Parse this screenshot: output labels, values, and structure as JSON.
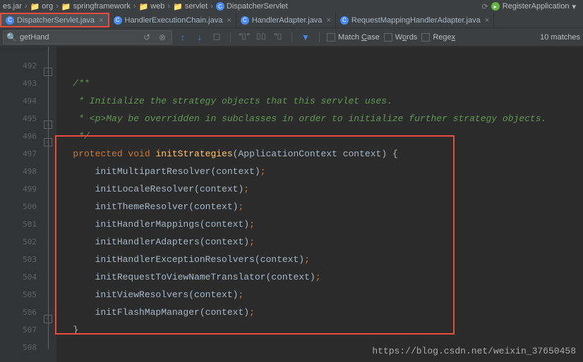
{
  "breadcrumb": {
    "items": [
      "es.jar",
      "org",
      "springframework",
      "web",
      "servlet",
      "DispatcherServlet"
    ]
  },
  "run_config": "RegisterApplication",
  "tabs": [
    {
      "label": "DispatcherServlet.java",
      "active": true
    },
    {
      "label": "HandlerExecutionChain.java",
      "active": false
    },
    {
      "label": "HandlerAdapter.java",
      "active": false
    },
    {
      "label": "RequestMappingHandlerAdapter.java",
      "active": false
    }
  ],
  "search": {
    "value": "getHand"
  },
  "options": {
    "match_case": "Match Case",
    "words": "Words",
    "regex": "Regex"
  },
  "matches": "10 matches",
  "lines": {
    "start": 492,
    "end": 508
  },
  "code": {
    "l492": "",
    "l493": "/**",
    "l494": " * Initialize the strategy objects that this servlet uses.",
    "l495": " * <p>May be overridden in subclasses in order to initialize further strategy objects.",
    "l496": " */",
    "l497_kw": "protected void ",
    "l497_method": "initStrategies",
    "l497_params": "ApplicationContext context",
    "l498": "initMultipartResolver",
    "l499": "initLocaleResolver",
    "l500": "initThemeResolver",
    "l501": "initHandlerMappings",
    "l502": "initHandlerAdapters",
    "l503": "initHandlerExceptionResolvers",
    "l504": "initRequestToViewNameTranslator",
    "l505": "initViewResolvers",
    "l506": "initFlashMapManager",
    "arg": "context"
  },
  "watermark": "https://blog.csdn.net/weixin_37650458"
}
